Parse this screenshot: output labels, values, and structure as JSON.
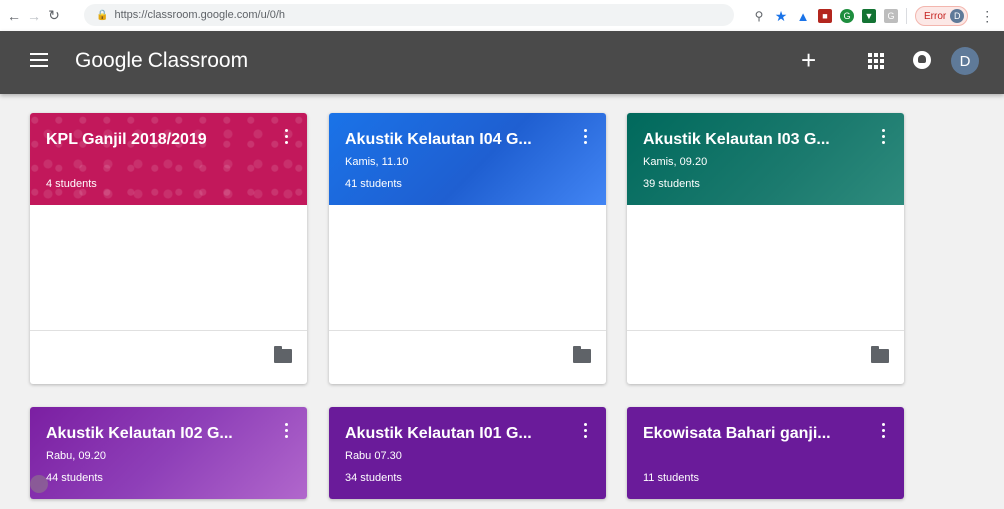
{
  "browser": {
    "url": "https://classroom.google.com/u/0/h",
    "error_label": "Error",
    "profile_initial": "D"
  },
  "appbar": {
    "brand_google": "Google",
    "brand_product": "Classroom",
    "avatar_initial": "D"
  },
  "classes": [
    {
      "title": "KPL Ganjil 2018/2019",
      "subtitle": "",
      "students": "4 students",
      "color": "#c2185b"
    },
    {
      "title": "Akustik Kelautan I04 G...",
      "subtitle": "Kamis, 11.10",
      "students": "41 students",
      "color": "#1a73e8"
    },
    {
      "title": "Akustik Kelautan I03 G...",
      "subtitle": "Kamis, 09.20",
      "students": "39 students",
      "color": "#00695c"
    },
    {
      "title": "Akustik Kelautan I02 G...",
      "subtitle": "Rabu, 09.20",
      "students": "44 students",
      "color": "#7b1fa2"
    },
    {
      "title": "Akustik Kelautan I01 G...",
      "subtitle": "Rabu 07.30",
      "students": "34 students",
      "color": "#6a1b9a"
    },
    {
      "title": "Ekowisata Bahari ganji...",
      "subtitle": "",
      "students": "11 students",
      "color": "#6a1b9a"
    }
  ]
}
